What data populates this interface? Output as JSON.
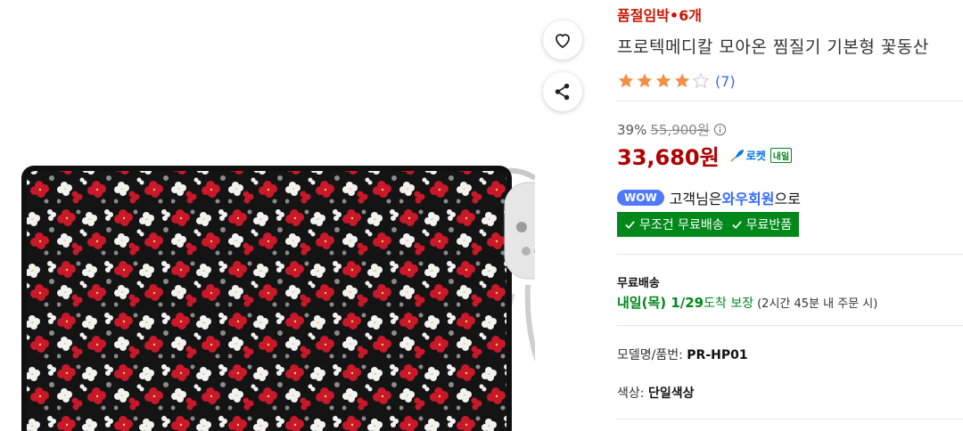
{
  "product": {
    "stock_notice": "품절임박•6개",
    "title": "프로텍메디칼 모아온 찜질기 기본형 꽃동산",
    "rating": 4,
    "rating_max": 5,
    "review_count": "(7)"
  },
  "price": {
    "discount_rate": "39%",
    "original": "55,900원",
    "sale": "33,680원",
    "rocket_label": "로켓",
    "rocket_badge": "내일"
  },
  "membership": {
    "badge": "WOW",
    "text_prefix": "고객님은 ",
    "member_label": "와우회원",
    "text_suffix": "으로"
  },
  "benefit": {
    "free_shipping": "무조건 무료배송",
    "free_return": "무료반품"
  },
  "shipping": {
    "label": "무료배송",
    "date": "내일(목) 1/29",
    "guarantee": " 도착 보장",
    "note": "(2시간 45분 내 주문 시)"
  },
  "specs": {
    "model_label": "모델명/품번: ",
    "model_value": "PR-HP01",
    "color_label": "색상: ",
    "color_value": "단일색상"
  },
  "icons": {
    "wishlist": "heart-icon",
    "share": "share-icon",
    "info": "info-icon",
    "rocket": "rocket-icon"
  },
  "colors": {
    "stock_red": "#cb1400",
    "price_red": "#ae0000",
    "star_orange": "#f58f44",
    "link_blue": "#346aff",
    "benefit_green": "#00891a",
    "pad_red": "#c8182a",
    "pad_black": "#111111"
  }
}
